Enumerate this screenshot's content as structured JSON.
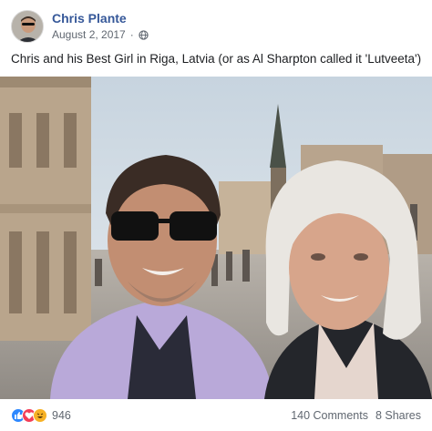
{
  "post": {
    "author": "Chris Plante",
    "date": "August 2, 2017",
    "separator": "·",
    "caption": "Chris and his Best Girl in Riga, Latvia (or as Al Sharpton called it 'Lutveeta')"
  },
  "icons": {
    "privacy": "globe-icon",
    "reactions": [
      "like-icon",
      "love-icon",
      "haha-icon"
    ]
  },
  "footer": {
    "reaction_count": "946",
    "comments": "140 Comments",
    "shares": "8 Shares"
  },
  "colors": {
    "author_link": "#365899",
    "meta_text": "#606770",
    "like": "#2d88ff",
    "love": "#f33e58",
    "haha": "#f7b125"
  }
}
